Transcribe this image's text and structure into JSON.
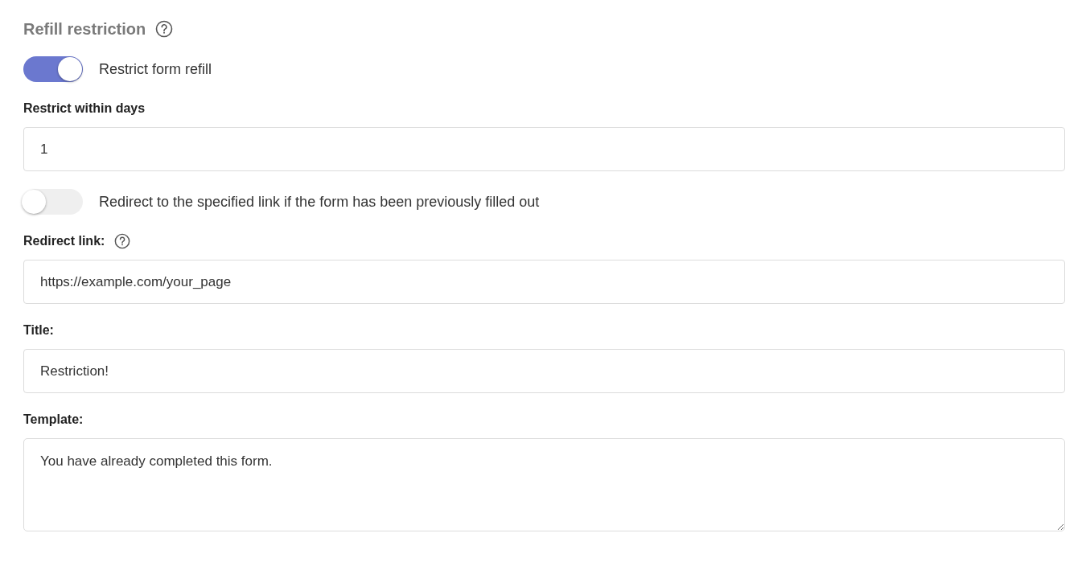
{
  "items": [
    {
      "kind": "heading",
      "text": "Refill restriction",
      "help": true
    },
    {
      "kind": "toggle",
      "label": "Restrict form refill",
      "on": true
    },
    {
      "kind": "field",
      "label": "Restrict within days",
      "help": false,
      "value": "1"
    },
    {
      "kind": "toggle",
      "label": "Redirect to the specified link if the form has been previously filled out",
      "on": false
    },
    {
      "kind": "field",
      "label": "Redirect link:",
      "help": true,
      "value": "https://example.com/your_page"
    },
    {
      "kind": "field",
      "label": "Title:",
      "help": false,
      "value": "Restriction!"
    },
    {
      "kind": "textarea",
      "label": "Template:",
      "help": false,
      "value": "You have already completed this form."
    }
  ]
}
